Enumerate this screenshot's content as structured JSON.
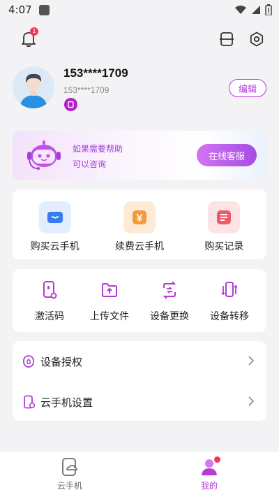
{
  "status_bar": {
    "time": "4:07"
  },
  "header": {
    "notification_count": "1"
  },
  "profile": {
    "name": "153****1709",
    "phone": "153****1709",
    "edit_label": "编辑"
  },
  "help": {
    "line1": "如果需要帮助",
    "line2": "可以咨询",
    "service_label": "在线客服"
  },
  "purchase_grid": [
    {
      "label": "购买云手机",
      "icon": "cloud-phone-icon",
      "color": "#3a7bf0"
    },
    {
      "label": "续费云手机",
      "icon": "yen-icon",
      "color": "#f59a3a"
    },
    {
      "label": "购买记录",
      "icon": "record-icon",
      "color": "#ef5a6a"
    }
  ],
  "tools": [
    {
      "label": "激活码",
      "icon": "activation-code-icon"
    },
    {
      "label": "上传文件",
      "icon": "upload-folder-icon"
    },
    {
      "label": "设备更换",
      "icon": "device-swap-icon"
    },
    {
      "label": "设备转移",
      "icon": "device-transfer-icon"
    }
  ],
  "menu": [
    {
      "label": "设备授权",
      "icon": "authorize-icon"
    },
    {
      "label": "云手机设置",
      "icon": "phone-settings-icon"
    }
  ],
  "tabs": [
    {
      "label": "云手机",
      "icon": "cloud-phone-tab-icon"
    },
    {
      "label": "我的",
      "icon": "user-tab-icon"
    }
  ],
  "colors": {
    "accent": "#b13cd6",
    "badge": "#f2385a",
    "background": "#f3f3f5"
  }
}
